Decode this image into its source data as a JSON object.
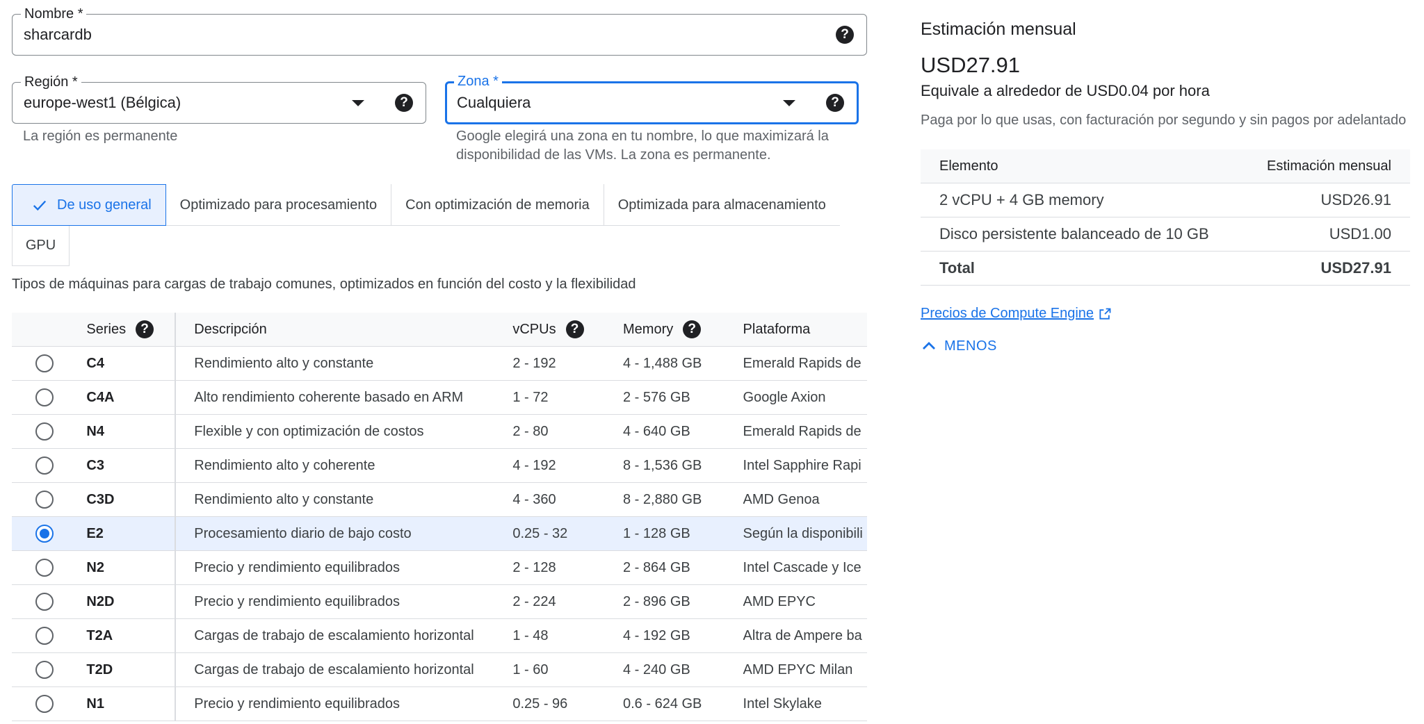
{
  "form": {
    "name": {
      "label": "Nombre *",
      "value": "sharcardb"
    },
    "region": {
      "label": "Región *",
      "value": "europe-west1 (Bélgica)",
      "hint": "La región es permanente"
    },
    "zone": {
      "label": "Zona *",
      "value": "Cualquiera",
      "hint_line1": "Google elegirá una zona en tu nombre, lo que maximizará la",
      "hint_line2": "disponibilidad de las VMs. La zona es permanente."
    }
  },
  "tabs": [
    {
      "label": "De uso general",
      "selected": true
    },
    {
      "label": "Optimizado para procesamiento"
    },
    {
      "label": "Con optimización de memoria"
    },
    {
      "label": "Optimizada para almacenamiento"
    },
    {
      "label": "GPU"
    }
  ],
  "tab_description": "Tipos de máquinas para cargas de trabajo comunes, optimizados en función del costo y la flexibilidad",
  "table": {
    "headers": {
      "series": "Series",
      "description": "Descripción",
      "vcpus": "vCPUs",
      "memory": "Memory",
      "platform": "Plataforma"
    },
    "rows": [
      {
        "series": "C4",
        "description": "Rendimiento alto y constante",
        "vcpus": "2 - 192",
        "memory": "4 - 1,488 GB",
        "platform": "Emerald Rapids de"
      },
      {
        "series": "C4A",
        "description": "Alto rendimiento coherente basado en ARM",
        "vcpus": "1 - 72",
        "memory": "2 - 576 GB",
        "platform": "Google Axion"
      },
      {
        "series": "N4",
        "description": "Flexible y con optimización de costos",
        "vcpus": "2 - 80",
        "memory": "4 - 640 GB",
        "platform": "Emerald Rapids de"
      },
      {
        "series": "C3",
        "description": "Rendimiento alto y coherente",
        "vcpus": "4 - 192",
        "memory": "8 - 1,536 GB",
        "platform": "Intel Sapphire Rapi"
      },
      {
        "series": "C3D",
        "description": "Rendimiento alto y constante",
        "vcpus": "4 - 360",
        "memory": "8 - 2,880 GB",
        "platform": "AMD Genoa"
      },
      {
        "series": "E2",
        "description": "Procesamiento diario de bajo costo",
        "vcpus": "0.25 - 32",
        "memory": "1 - 128 GB",
        "platform": "Según la disponibili",
        "selected": true
      },
      {
        "series": "N2",
        "description": "Precio y rendimiento equilibrados",
        "vcpus": "2 - 128",
        "memory": "2 - 864 GB",
        "platform": "Intel Cascade y Ice"
      },
      {
        "series": "N2D",
        "description": "Precio y rendimiento equilibrados",
        "vcpus": "2 - 224",
        "memory": "2 - 896 GB",
        "platform": "AMD EPYC"
      },
      {
        "series": "T2A",
        "description": "Cargas de trabajo de escalamiento horizontal",
        "vcpus": "1 - 48",
        "memory": "4 - 192 GB",
        "platform": "Altra de Ampere ba"
      },
      {
        "series": "T2D",
        "description": "Cargas de trabajo de escalamiento horizontal",
        "vcpus": "1 - 60",
        "memory": "4 - 240 GB",
        "platform": "AMD EPYC Milan"
      },
      {
        "series": "N1",
        "description": "Precio y rendimiento equilibrados",
        "vcpus": "0.25 - 96",
        "memory": "0.6 - 624 GB",
        "platform": "Intel Skylake"
      }
    ]
  },
  "estimate": {
    "title": "Estimación mensual",
    "price": "USD27.91",
    "per_hour": "Equivale a alrededor de USD0.04 por hora",
    "note": "Paga por lo que usas, con facturación por segundo y sin pagos por adelantado",
    "headers": {
      "item": "Elemento",
      "monthly": "Estimación mensual"
    },
    "items": [
      {
        "item": "2 vCPU + 4 GB memory",
        "monthly": "USD26.91"
      },
      {
        "item": "Disco persistente balanceado de 10 GB",
        "monthly": "USD1.00"
      }
    ],
    "total": {
      "label": "Total",
      "value": "USD27.91"
    },
    "link": "Precios de Compute Engine",
    "less": "MENOS"
  },
  "colors": {
    "accent": "#1a73e8",
    "selected_row": "#e8f0fe"
  }
}
